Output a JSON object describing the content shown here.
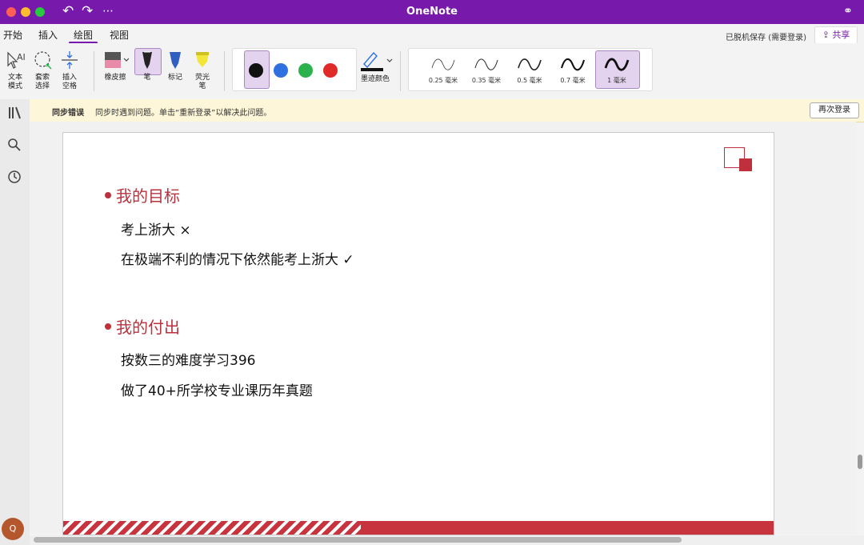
{
  "window": {
    "title": "OneNote"
  },
  "menu": {
    "items": [
      "开始",
      "插入",
      "绘图",
      "视图"
    ],
    "active": "绘图"
  },
  "status": {
    "save": "已脱机保存 (需要登录)",
    "share": "共享"
  },
  "ribbon": {
    "text_mode": "文本\n模式",
    "lasso": "套索\n选择",
    "insert_space": "插入\n空格",
    "eraser": "橡皮擦",
    "pen": "笔",
    "marker": "标记",
    "highlighter": "荧光\n笔",
    "ink_color": "墨迹颜色",
    "colors": [
      "#111111",
      "#2f6fe0",
      "#2bb24c",
      "#e02a2a"
    ],
    "thicknesses": [
      "0.25 毫米",
      "0.35 毫米",
      "0.5 毫米",
      "0.7 毫米",
      "1 毫米"
    ],
    "selected_thickness": "1 毫米"
  },
  "notice": {
    "title": "同步错误",
    "message": "同步时遇到问题。单击“重新登录”以解决此问题。",
    "retry": "再次登录"
  },
  "user": {
    "initial": "Q"
  },
  "note": {
    "section1": {
      "heading": "我的目标",
      "lines": [
        "考上浙大 ×",
        "在极端不利的情况下依然能考上浙大  ✓"
      ]
    },
    "section2": {
      "heading": "我的付出",
      "lines": [
        "按数三的难度学习396",
        "做了40+所学校专业课历年真题"
      ]
    }
  },
  "accent_colors": {
    "brand": "#7719aa",
    "note_red": "#c0303c"
  }
}
